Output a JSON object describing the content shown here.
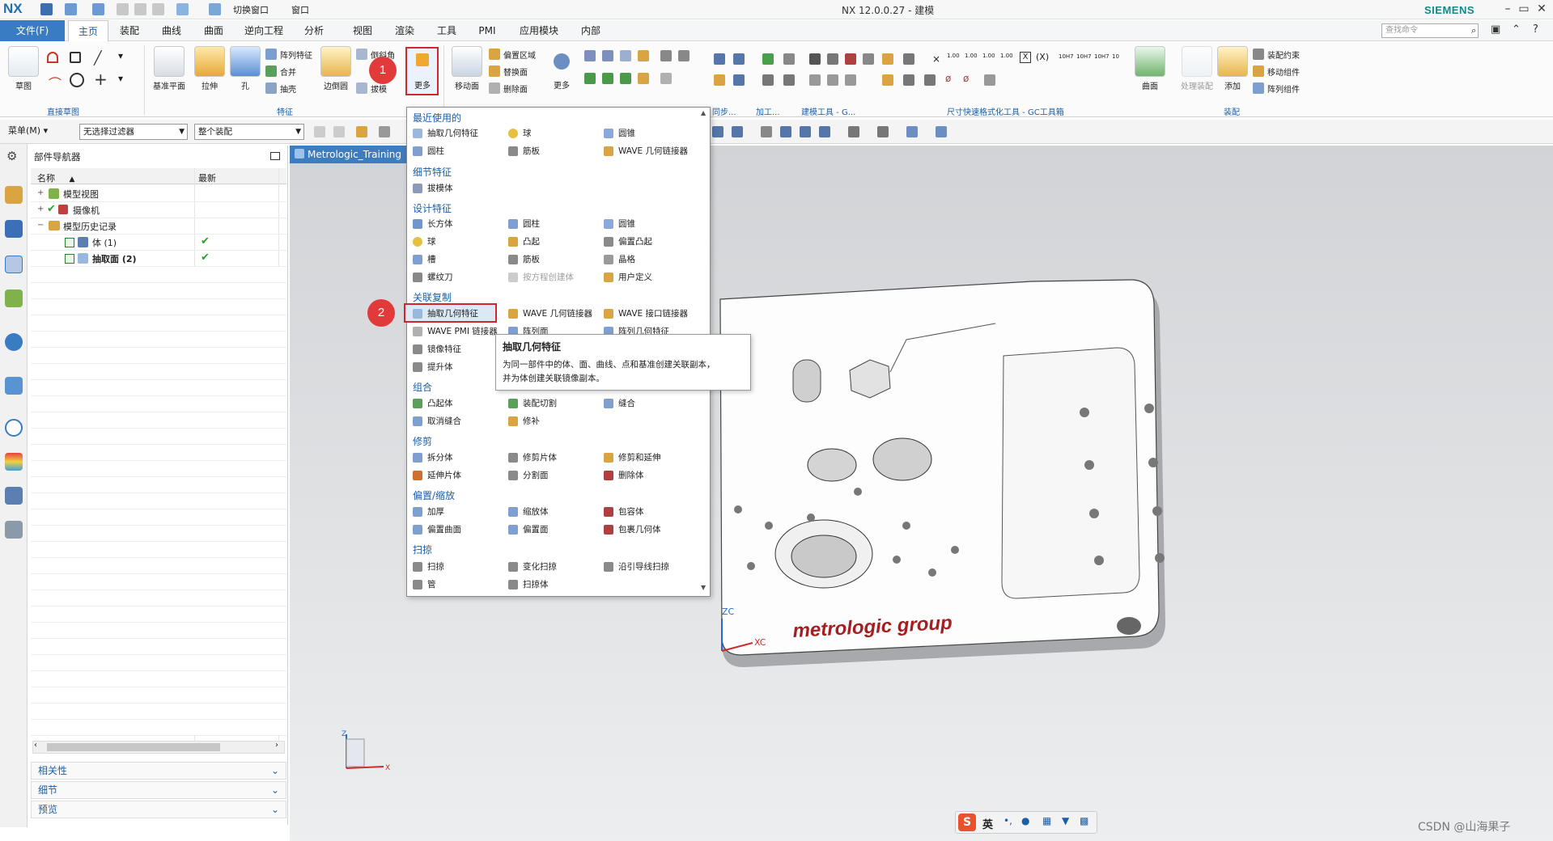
{
  "titlebar": {
    "logo": "NX",
    "switch_window": "切换窗口",
    "window": "窗口",
    "title": "NX 12.0.0.27 - 建模",
    "brand": "SIEMENS"
  },
  "menubar": {
    "file": "文件(F)",
    "tabs": [
      "主页",
      "装配",
      "曲线",
      "曲面",
      "逆向工程",
      "分析",
      "视图",
      "渲染",
      "工具",
      "PMI",
      "应用模块",
      "内部"
    ],
    "search_placeholder": "查找命令"
  },
  "ribbon": {
    "sketch": "草图",
    "datum_plane": "基准平面",
    "extrude": "拉伸",
    "hole": "孔",
    "pattern_feature": "阵列特征",
    "unite": "合并",
    "shell": "抽壳",
    "edge_blend": "边倒圆",
    "chamfer": "倒斜角",
    "draft": "拔模",
    "more": "更多",
    "move_face": "移动面",
    "offset_region": "偏置区域",
    "replace_face": "替换面",
    "delete_face": "删除面",
    "more2": "更多",
    "surface": "曲面",
    "process_assembly": "处理装配",
    "add": "添加",
    "assembly_constraint": "装配约束",
    "move_component": "移动组件",
    "pattern_component": "阵列组件",
    "groups": {
      "direct_sketch": "直接草图",
      "feature": "特征",
      "sync": "同步...",
      "machining": "加工...",
      "modeling_tools": "建模工具 - G...",
      "dim_tools": "尺寸快速格式化工具 - GC工具箱",
      "assembly": "装配"
    },
    "tol_labels": [
      "1.00",
      "1.00",
      "1.00",
      "1.00",
      "10H7",
      "10H7",
      "10H7",
      "10"
    ]
  },
  "filterbar": {
    "menu": "菜单(M)",
    "filter": "无选择过滤器",
    "scope": "整个装配"
  },
  "navigator": {
    "title": "部件导航器",
    "col_name": "名称",
    "col_latest": "最新",
    "rows": [
      {
        "label": "模型视图",
        "level": 0
      },
      {
        "label": "摄像机",
        "level": 0
      },
      {
        "label": "模型历史记录",
        "level": 0
      },
      {
        "label": "体 (1)",
        "level": 1
      },
      {
        "label": "抽取面 (2)",
        "level": 1
      }
    ],
    "panels": [
      "相关性",
      "细节",
      "预览"
    ]
  },
  "graphics": {
    "tab": "Metrologic_Training",
    "logo_text": "metrologic group",
    "axis_zc": "ZC",
    "axis_xc": "XC",
    "triad_z": "Z",
    "triad_x": "X"
  },
  "dropdown": {
    "sections": [
      {
        "title": "最近使用的",
        "items": [
          "抽取几何特征",
          "球",
          "圆锥",
          "圆柱",
          "筋板",
          "WAVE 几何链接器"
        ]
      },
      {
        "title": "细节特征",
        "items": [
          "拔模体"
        ]
      },
      {
        "title": "设计特征",
        "items": [
          "长方体",
          "圆柱",
          "圆锥",
          "球",
          "凸起",
          "偏置凸起",
          "槽",
          "筋板",
          "晶格",
          "螺纹刀",
          "按方程创建体",
          "用户定义"
        ]
      },
      {
        "title": "关联复制",
        "items": [
          "抽取几何特征",
          "WAVE 几何链接器",
          "WAVE 接口链接器",
          "WAVE PMI 链接器",
          "阵列面",
          "阵列几何特征",
          "镜像特征",
          "",
          "",
          "提升体",
          "",
          ""
        ]
      },
      {
        "title": "组合",
        "items": [
          "凸起体",
          "装配切割",
          "缝合",
          "取消缝合",
          "修补",
          ""
        ]
      },
      {
        "title": "修剪",
        "items": [
          "拆分体",
          "修剪片体",
          "修剪和延伸",
          "延伸片体",
          "分割面",
          "删除体"
        ]
      },
      {
        "title": "偏置/缩放",
        "items": [
          "加厚",
          "缩放体",
          "包容体",
          "偏置曲面",
          "偏置面",
          "包裹几何体"
        ]
      },
      {
        "title": "扫掠",
        "items": [
          "扫掠",
          "变化扫掠",
          "沿引导线扫掠",
          "管",
          "扫掠体",
          ""
        ]
      }
    ]
  },
  "tooltip": {
    "title": "抽取几何特征",
    "line1": "为同一部件中的体、面、曲线、点和基准创建关联副本，",
    "line2": "并为体创建关联镜像副本。"
  },
  "callouts": [
    "1",
    "2"
  ],
  "ime": {
    "lang": "英"
  },
  "watermark": "CSDN @山海果子",
  "colors": {
    "accent": "#3a7cc4",
    "highlight_red": "#d0262e",
    "callout_red": "#e23a3a",
    "section_blue": "#1b5fa8"
  }
}
